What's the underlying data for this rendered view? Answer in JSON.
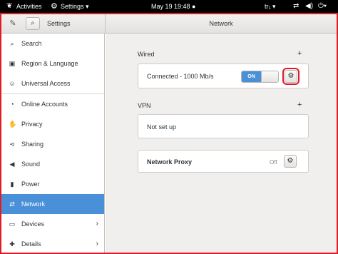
{
  "topbar": {
    "activities_icon": "gnome-foot-icon",
    "activities": "Activities",
    "app_icon": "settings-icon",
    "app_menu": "Settings ▾",
    "clock": "May 19  19:48 ●",
    "keyboard": "tr₁ ▾",
    "network_icon": "network-icon",
    "volume_icon": "volume-icon",
    "power_icon": "power-icon"
  },
  "header": {
    "tools_icon": "tools-icon",
    "search_icon": "search-icon",
    "sidebar_title": "Settings",
    "main_title": "Network"
  },
  "sidebar": {
    "items": [
      {
        "label": "Search",
        "icon": "search-icon"
      },
      {
        "label": "Region & Language",
        "icon": "camera-icon"
      },
      {
        "label": "Universal Access",
        "icon": "accessibility-icon"
      },
      {
        "label": "Online Accounts",
        "icon": "online-accounts-icon"
      },
      {
        "label": "Privacy",
        "icon": "privacy-icon"
      },
      {
        "label": "Sharing",
        "icon": "share-icon"
      },
      {
        "label": "Sound",
        "icon": "speaker-icon"
      },
      {
        "label": "Power",
        "icon": "power-icon"
      },
      {
        "label": "Network",
        "icon": "network-icon",
        "active": true
      },
      {
        "label": "Devices",
        "icon": "devices-icon",
        "chevron": "›"
      },
      {
        "label": "Details",
        "icon": "details-icon",
        "chevron": "›"
      }
    ]
  },
  "main": {
    "wired": {
      "title": "Wired",
      "add": "+",
      "status": "Connected - 1000 Mb/s",
      "toggle": "ON",
      "gear_icon": "gear-icon"
    },
    "vpn": {
      "title": "VPN",
      "add": "+",
      "status": "Not set up"
    },
    "proxy": {
      "label": "Network Proxy",
      "status": "Off",
      "gear_icon": "gear-icon"
    }
  },
  "colors": {
    "accent": "#4a90d9",
    "highlight_box": "#e01b24",
    "topbar": "#000000"
  }
}
